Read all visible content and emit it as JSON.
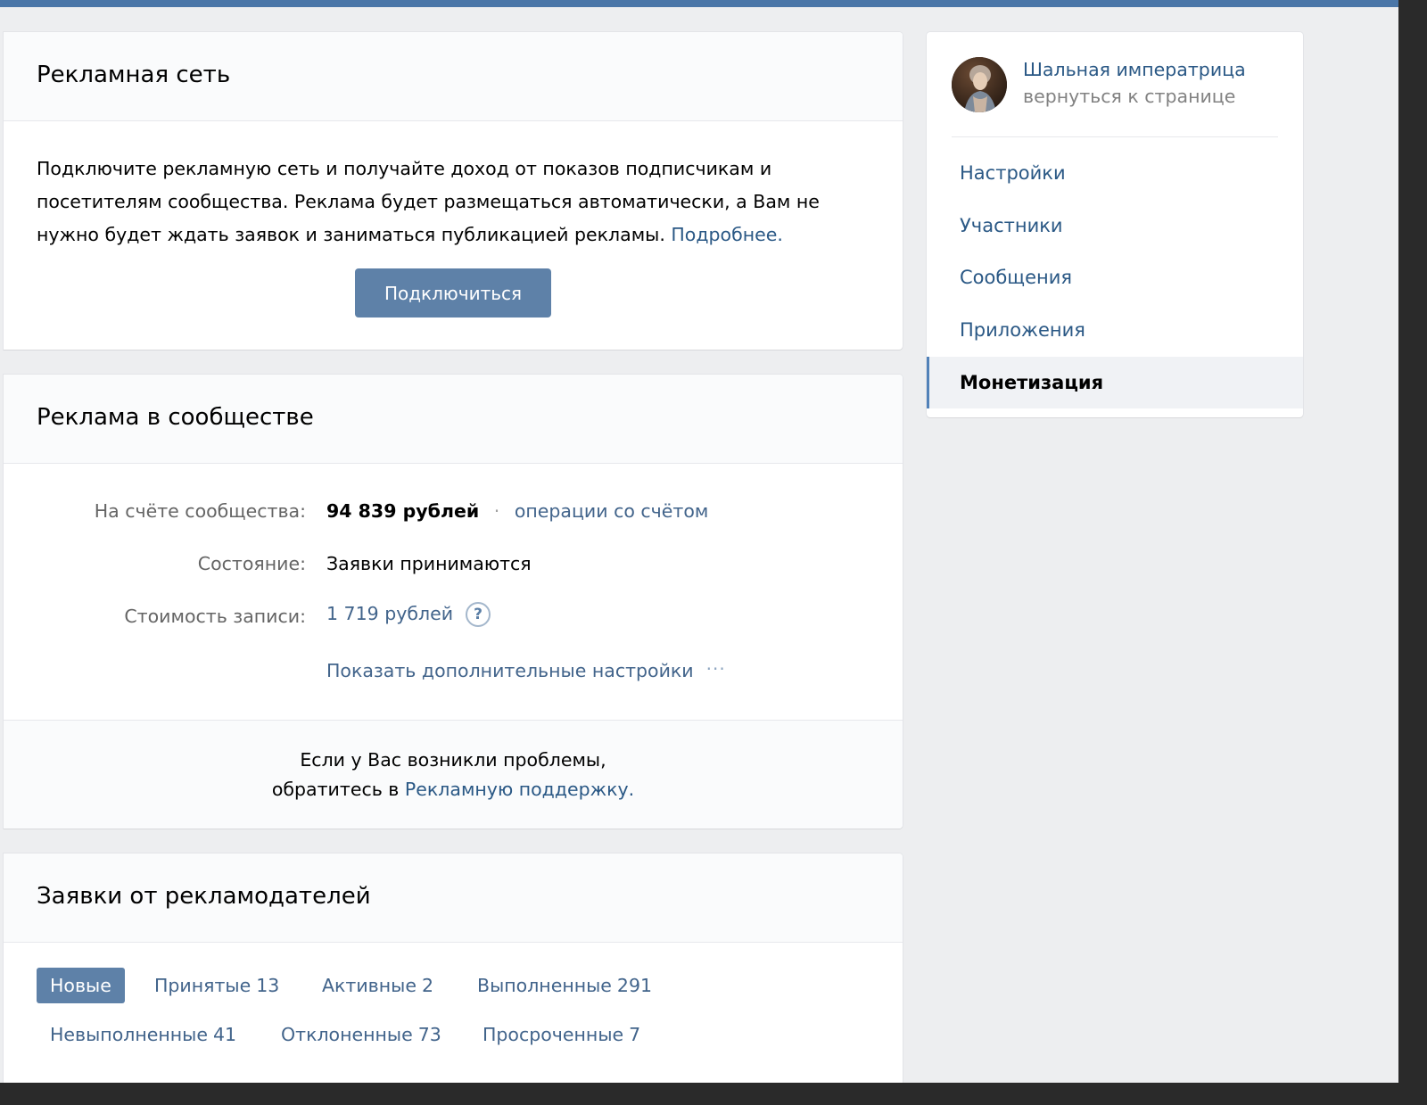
{
  "ad_network": {
    "title": "Рекламная сеть",
    "description_line1": "Подключите рекламную сеть и получайте доход от показов подписчикам и",
    "description_line2": "посетителям сообщества. Реклама будет размещаться автоматически, а Вам не",
    "description_line3": "нужно будет ждать заявок и заниматься публикацией рекламы.",
    "more_link": "Подробнее.",
    "connect_button": "Подключиться"
  },
  "community_ads": {
    "title": "Реклама в сообществе",
    "balance_label": "На счёте сообщества:",
    "balance_value": "94 839 рублей",
    "separator": "·",
    "operations_link": "операции со счётом",
    "status_label": "Состояние:",
    "status_value": "Заявки принимаются",
    "price_label": "Стоимость записи:",
    "price_value": "1 719 рублей",
    "help_icon_text": "?",
    "more_settings_link": "Показать дополнительные настройки",
    "more_settings_dots": "···",
    "support_line1": "Если у Вас возникли проблемы,",
    "support_line2_prefix": "обратитесь в",
    "support_link": "Рекламную поддержку."
  },
  "requests": {
    "title": "Заявки от рекламодателей",
    "tabs": [
      {
        "label": "Новые",
        "count": ""
      },
      {
        "label": "Принятые",
        "count": "13"
      },
      {
        "label": "Активные",
        "count": "2"
      },
      {
        "label": "Выполненные",
        "count": "291"
      },
      {
        "label": "Невыполненные",
        "count": "41"
      },
      {
        "label": "Отклоненные",
        "count": "73"
      },
      {
        "label": "Просроченные",
        "count": "7"
      }
    ]
  },
  "sidebar": {
    "community_name": "Шальная императрица",
    "back_link": "вернуться к странице",
    "items": [
      {
        "label": "Настройки"
      },
      {
        "label": "Участники"
      },
      {
        "label": "Сообщения"
      },
      {
        "label": "Приложения"
      },
      {
        "label": "Монетизация"
      }
    ]
  },
  "colors": {
    "accent": "#4a76a8",
    "button": "#5e81a8",
    "link": "#2a5885",
    "background": "#edeef0"
  }
}
